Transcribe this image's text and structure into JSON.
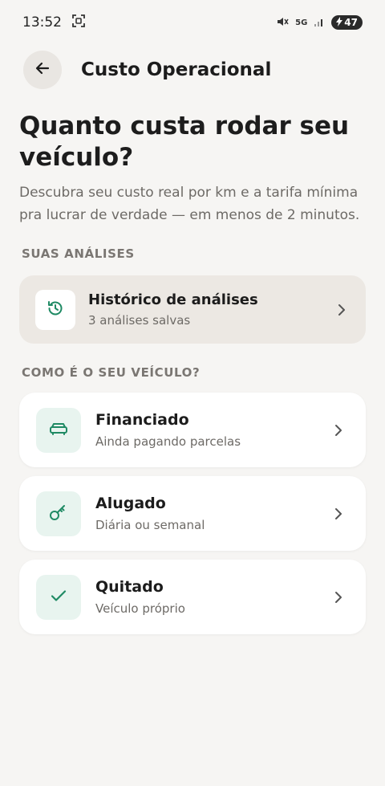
{
  "status_bar": {
    "time": "13:52",
    "network": "5G",
    "battery": "47"
  },
  "header": {
    "title": "Custo Operacional"
  },
  "hero": {
    "title": "Quanto custa rodar seu veículo?",
    "subtitle": "Descubra seu custo real por km e a tarifa mínima pra lucrar de verdade — em menos de 2 minutos."
  },
  "analyses": {
    "section_label": "SUAS ANÁLISES",
    "history": {
      "title": "Histórico de análises",
      "subtitle": "3 análises salvas",
      "icon": "history-icon"
    }
  },
  "vehicle": {
    "section_label": "COMO É O SEU VEÍCULO?",
    "options": [
      {
        "title": "Financiado",
        "subtitle": "Ainda pagando parcelas",
        "icon": "car-icon"
      },
      {
        "title": "Alugado",
        "subtitle": "Diária ou semanal",
        "icon": "key-icon"
      },
      {
        "title": "Quitado",
        "subtitle": "Veículo próprio",
        "icon": "check-icon"
      }
    ]
  },
  "colors": {
    "accent": "#1f8a64",
    "icon_bg": "#e8f4ef",
    "background": "#f6f5f3"
  }
}
